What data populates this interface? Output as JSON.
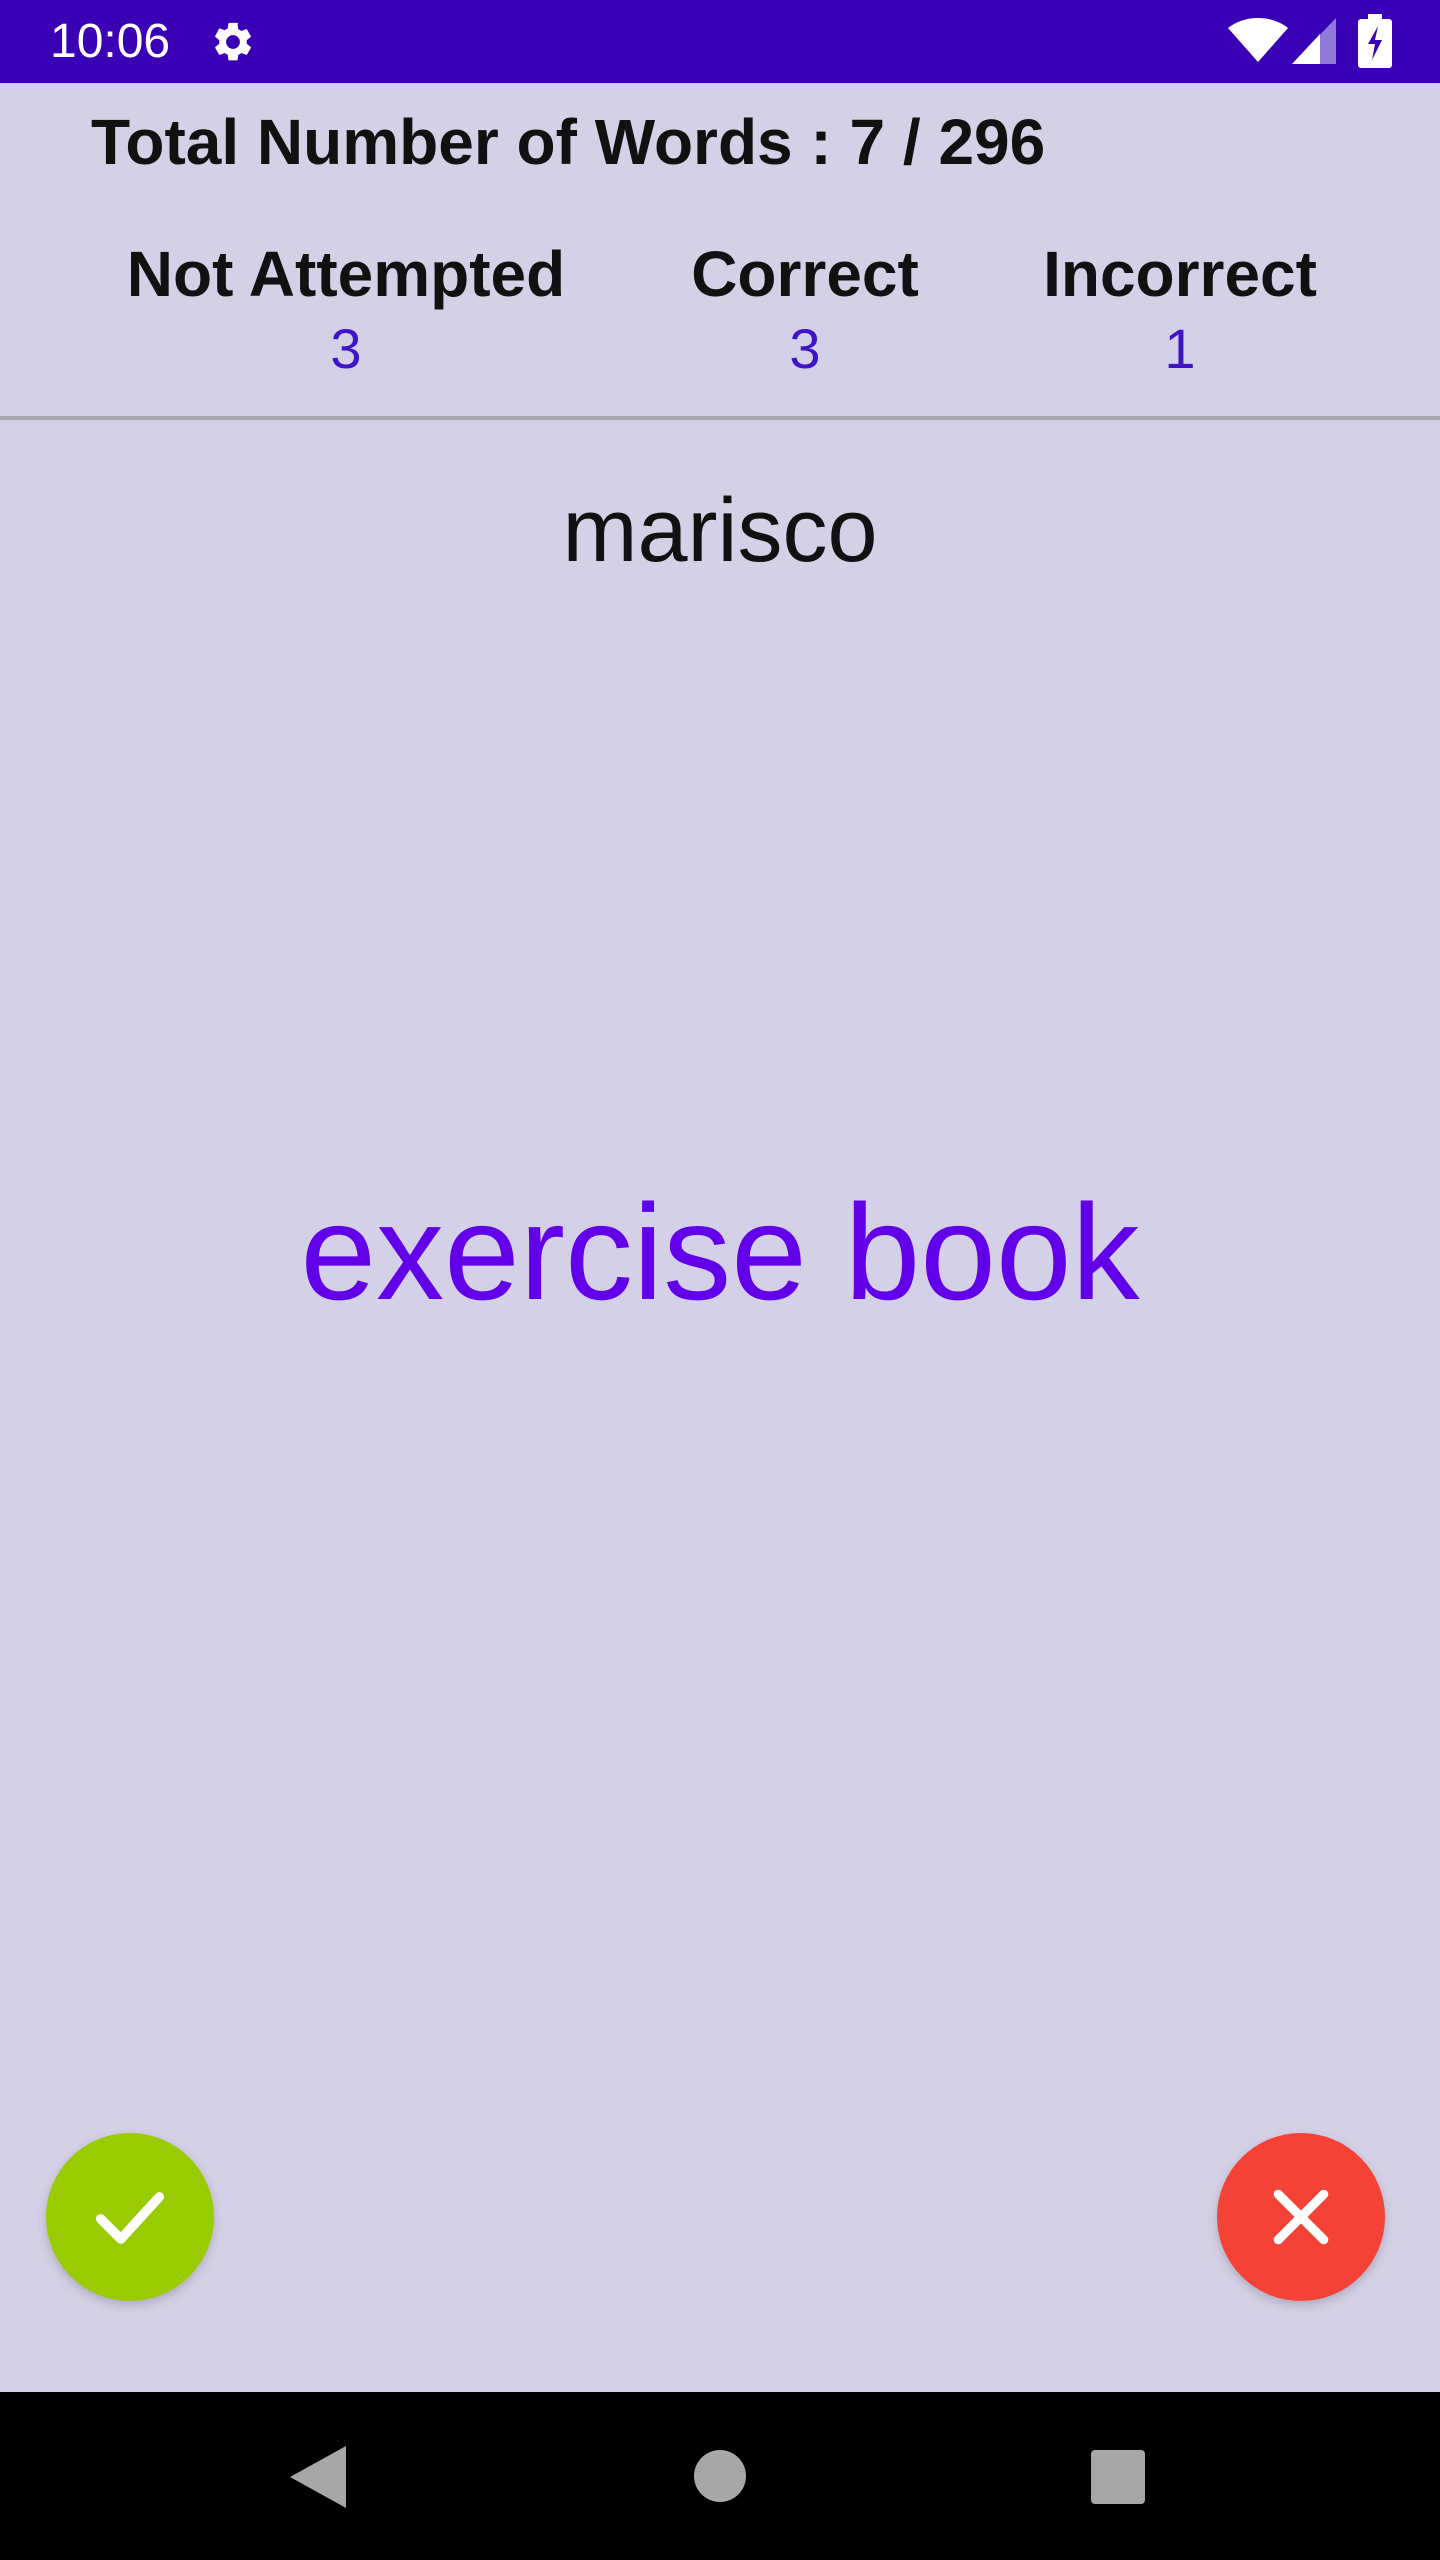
{
  "status_bar": {
    "time": "10:06",
    "icons": [
      "gear-icon",
      "wifi-icon",
      "signal-icon",
      "battery-charging-icon"
    ],
    "color": "#3a00b5"
  },
  "progress": {
    "total_line": "Total Number of Words : 7 / 296"
  },
  "stats": {
    "not_attempted": {
      "label": "Not Attempted",
      "value": "3"
    },
    "correct": {
      "label": "Correct",
      "value": "3"
    },
    "incorrect": {
      "label": "Incorrect",
      "value": "1"
    }
  },
  "card": {
    "word": "marisco",
    "translation": "exercise book"
  },
  "actions": {
    "correct_button": {
      "icon": "checkmark-icon",
      "color": "#99cc00"
    },
    "incorrect_button": {
      "icon": "close-icon",
      "color": "#f44336"
    }
  },
  "nav_bar": {
    "icons": [
      "back-icon",
      "home-icon",
      "recents-icon"
    ]
  },
  "colors": {
    "background": "#d4d0e7",
    "accent": "#6200ea",
    "stat_value": "#3f14c6"
  }
}
